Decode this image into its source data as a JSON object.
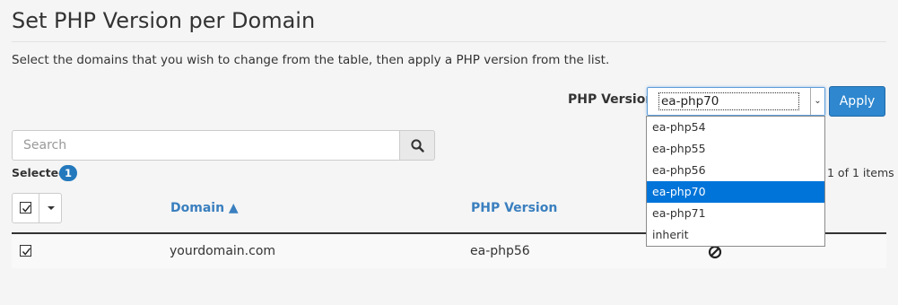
{
  "page": {
    "title": "Set PHP Version per Domain",
    "description": "Select the domains that you wish to change from the table, then apply a PHP version from the list."
  },
  "php_picker": {
    "label": "PHP Version",
    "selected": "ea-php70",
    "apply_label": "Apply",
    "options": [
      "ea-php54",
      "ea-php55",
      "ea-php56",
      "ea-php70",
      "ea-php71",
      "inherit"
    ]
  },
  "search": {
    "placeholder": "Search",
    "icon": "search-icon"
  },
  "selection": {
    "label": "Selected",
    "count": "1"
  },
  "pagination": {
    "info": "1 of 1 items"
  },
  "table": {
    "columns": [
      {
        "label": "Domain ▲"
      },
      {
        "label": "PHP Version"
      }
    ],
    "rows": [
      {
        "checked": true,
        "domain": "yourdomain.com",
        "php_version": "ea-php56",
        "status_icon": "not-allowed-icon"
      }
    ]
  },
  "colors": {
    "accent": "#2e87cf",
    "link": "#3a7fbf",
    "highlight": "#0074d9"
  }
}
